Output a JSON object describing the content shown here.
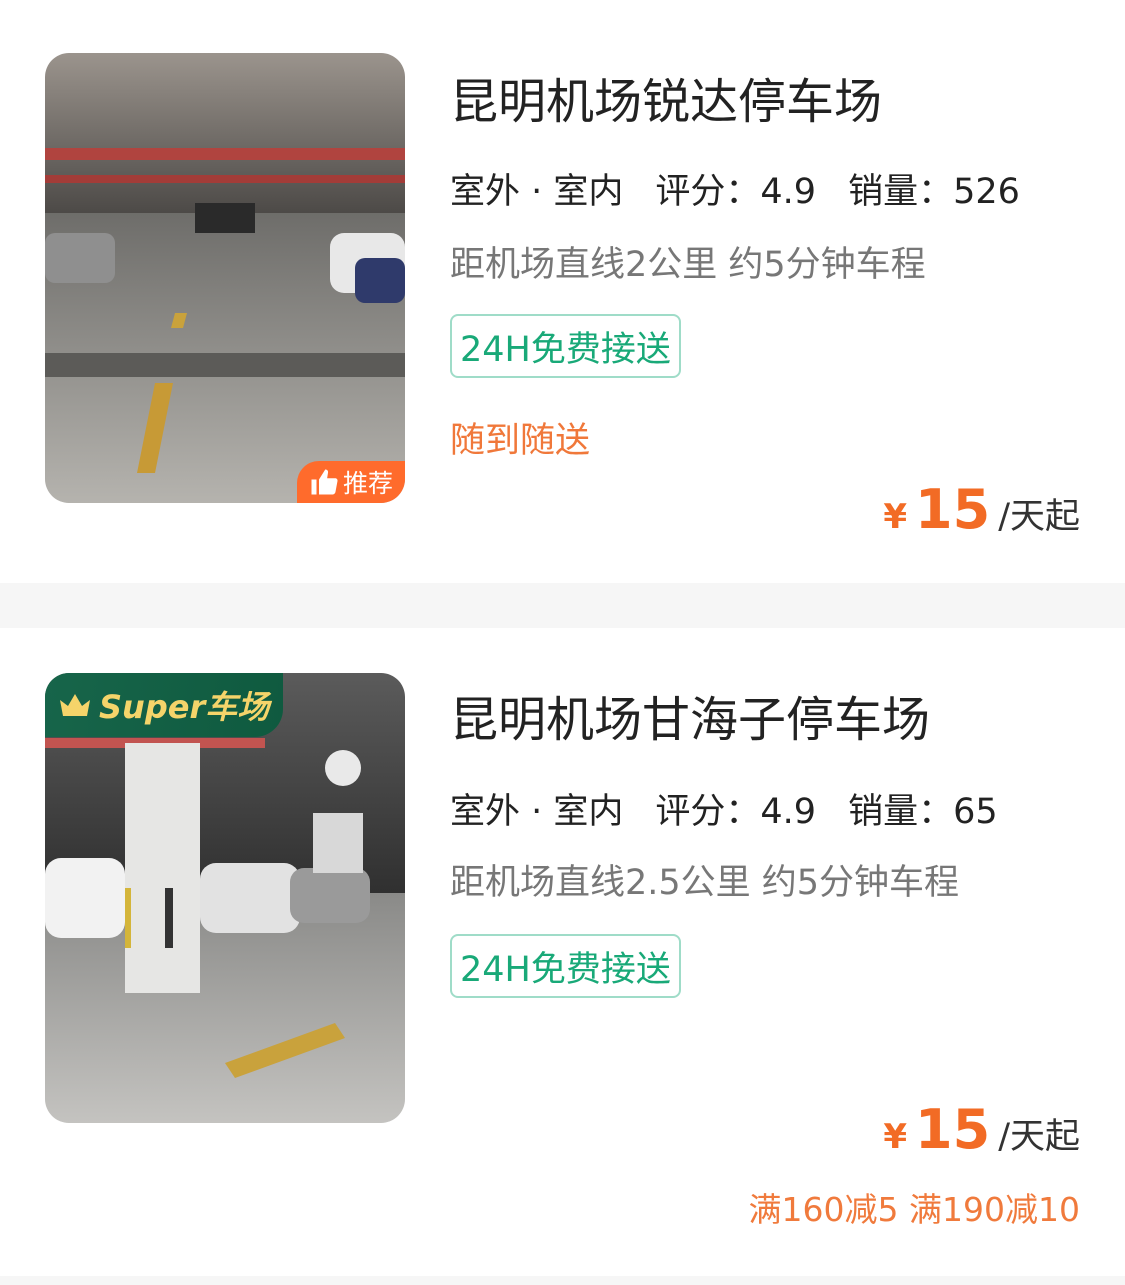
{
  "listings": [
    {
      "name": "昆明机场锐达停车场",
      "env": "室外 · 室内",
      "rating": "评分：4.9",
      "sales": "销量：526",
      "distance": "距机场直线2公里 约5分钟车程",
      "badge": "24H免费接送",
      "service": "随到随送",
      "photo_tag": "推荐",
      "currency": "¥",
      "price": "15",
      "price_unit": "/天起"
    },
    {
      "name": "昆明机场甘海子停车场",
      "env": "室外 · 室内",
      "rating": "评分：4.9",
      "sales": "销量：65",
      "distance": "距机场直线2.5公里 约5分钟车程",
      "badge": "24H免费接送",
      "photo_tag": "Super车场",
      "currency": "¥",
      "price": "15",
      "price_unit": "/天起",
      "promo": "满160减5 满190减10"
    }
  ],
  "colors": {
    "accent_orange": "#f26b25",
    "green": "#19a978",
    "super_green": "#17654a",
    "gold": "#f5d46a"
  }
}
